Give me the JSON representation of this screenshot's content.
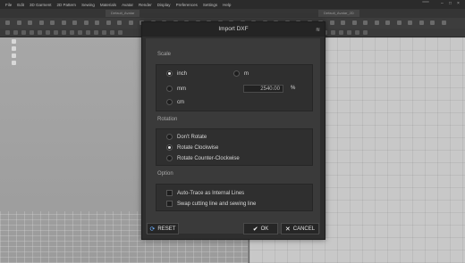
{
  "app": {
    "menu": [
      "File",
      "Edit",
      "3D Garment",
      "2D Pattern",
      "Sewing",
      "Materials",
      "Avatar",
      "Render",
      "Display",
      "Preferences",
      "Settings",
      "Help"
    ],
    "brand_badge": "",
    "tabs": [
      "Default_Avatar",
      "Default_Avatar_2D"
    ]
  },
  "dialog": {
    "title": "Import DXF",
    "scale": {
      "label": "Scale",
      "options": [
        "inch",
        "m",
        "mm",
        "cm"
      ],
      "selected": "inch",
      "value": "2540.00",
      "unit": "%"
    },
    "rotation": {
      "label": "Rotation",
      "options": [
        "Don't Rotate",
        "Rotate Clockwise",
        "Rotate Counter-Clockwise"
      ],
      "selected": "Rotate Clockwise"
    },
    "option": {
      "label": "Option",
      "checkboxes": [
        "Auto-Trace as Internal Lines",
        "Swap cutting line and sewing line"
      ]
    },
    "buttons": {
      "reset": "RESET",
      "ok": "OK",
      "cancel": "CANCEL"
    }
  },
  "colors": {
    "dialog_bg": "#2e2e2e",
    "panel_bg": "#2f2f2f",
    "accent_blue": "#6fb2ff"
  }
}
